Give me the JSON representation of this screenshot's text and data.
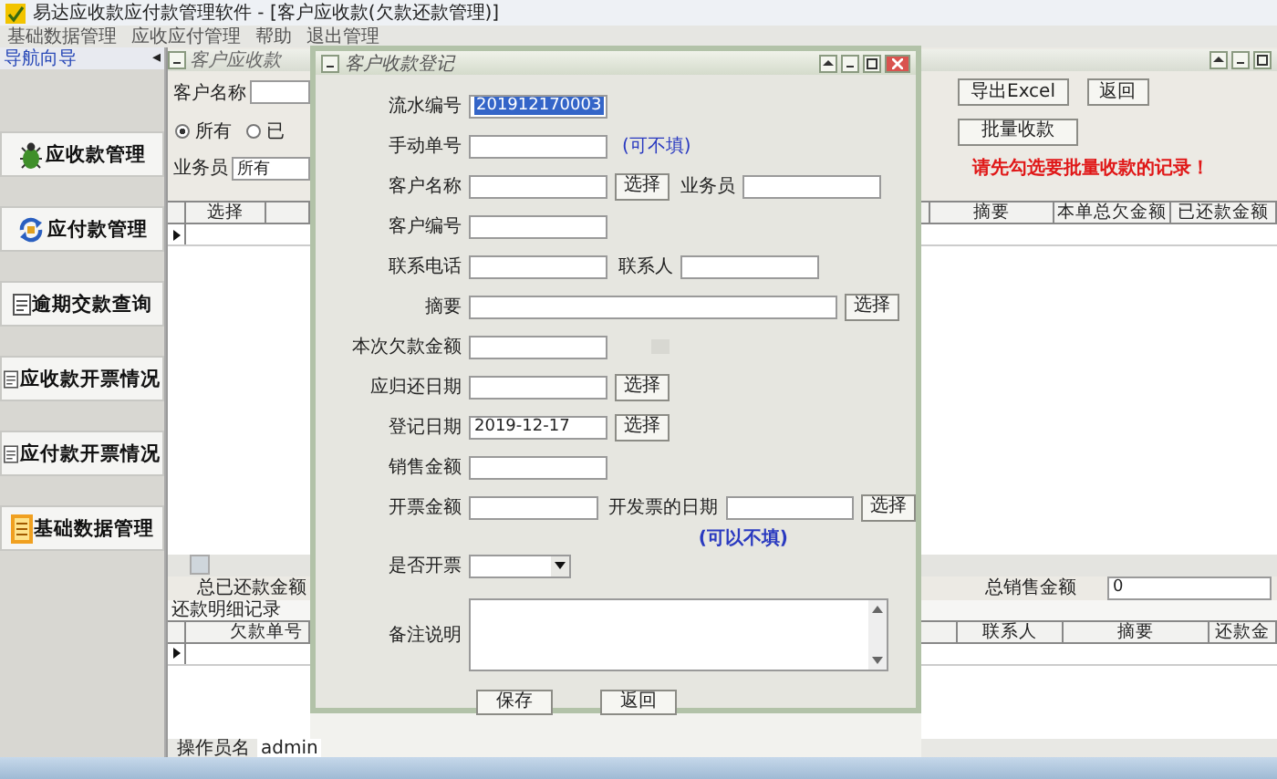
{
  "window": {
    "title": "易达应收款应付款管理软件 - [客户应收款(欠款还款管理)]"
  },
  "menu": [
    "基础数据管理",
    "应收应付管理",
    "帮助",
    "退出管理"
  ],
  "nav": {
    "title": "导航向导",
    "collapse": "◂",
    "items": [
      "应收款管理",
      "应付款管理",
      "逾期交款查询",
      "应收款开票情况",
      "应付款开票情况",
      "基础数据管理"
    ]
  },
  "main": {
    "title": "客户应收款",
    "customer_label": "客户名称",
    "radios": [
      {
        "label": "所有",
        "selected": true
      },
      {
        "label": "已",
        "selected": false
      }
    ],
    "salesman_label": "业务员",
    "salesman_value": "所有",
    "buttons": [
      "导出Excel",
      "返回"
    ],
    "batch_button": "批量收款",
    "notice": "请先勾选要批量收款的记录！",
    "columns_left": [
      "选择"
    ],
    "columns_right": [
      "摘要",
      "本单总欠金额",
      "已还款金额"
    ],
    "total_repaid_label": "总已还款金额",
    "total_sales_label": "总销售金额",
    "total_sales_value": "0",
    "detail_title": "还款明细记录",
    "detail_columns_left": [
      "欠款单号"
    ],
    "detail_columns_right": [
      "联系人",
      "摘要",
      "还款金"
    ],
    "operator_label": "操作员名",
    "operator_value": "admin"
  },
  "dialog": {
    "title": "客户收款登记",
    "rows": [
      {
        "items": [
          {
            "kind": "label",
            "text": "流水编号"
          },
          {
            "kind": "highlighted-field",
            "value": "201912170003"
          }
        ]
      },
      {
        "items": [
          {
            "kind": "label",
            "text": "手动单号"
          },
          {
            "kind": "field"
          },
          {
            "kind": "note",
            "text": "(可不填)"
          }
        ]
      },
      {
        "items": [
          {
            "kind": "label",
            "text": "客户名称"
          },
          {
            "kind": "field"
          },
          {
            "kind": "button",
            "text": "选择"
          },
          {
            "kind": "inline-label",
            "text": "业务员"
          },
          {
            "kind": "field"
          }
        ]
      },
      {
        "items": [
          {
            "kind": "label",
            "text": "客户编号"
          },
          {
            "kind": "field"
          }
        ]
      },
      {
        "items": [
          {
            "kind": "label",
            "text": "联系电话"
          },
          {
            "kind": "field"
          },
          {
            "kind": "inline-label",
            "text": "联系人"
          },
          {
            "kind": "field"
          }
        ]
      },
      {
        "items": [
          {
            "kind": "label",
            "text": "摘要"
          },
          {
            "kind": "wide-field"
          },
          {
            "kind": "button",
            "text": "选择"
          }
        ]
      },
      {
        "items": [
          {
            "kind": "label",
            "text": "本次欠款金额"
          },
          {
            "kind": "field"
          },
          {
            "kind": "disabled-box"
          }
        ]
      },
      {
        "items": [
          {
            "kind": "label",
            "text": "应归还日期"
          },
          {
            "kind": "field"
          },
          {
            "kind": "button",
            "text": "选择"
          }
        ]
      },
      {
        "items": [
          {
            "kind": "label",
            "text": "登记日期"
          },
          {
            "kind": "field",
            "value": "2019-12-17"
          },
          {
            "kind": "button",
            "text": "选择"
          }
        ]
      },
      {
        "items": [
          {
            "kind": "label",
            "text": "销售金额"
          },
          {
            "kind": "field"
          }
        ]
      },
      {
        "items": [
          {
            "kind": "label",
            "text": "开票金额"
          },
          {
            "kind": "field"
          },
          {
            "kind": "inline-label",
            "text": "开发票的日期"
          },
          {
            "kind": "field"
          },
          {
            "kind": "button",
            "text": "选择"
          }
        ]
      },
      {
        "items": [
          {
            "kind": "bold-note",
            "text": "(可以不填)"
          }
        ]
      },
      {
        "items": [
          {
            "kind": "label",
            "text": "是否开票"
          },
          {
            "kind": "dropdown"
          }
        ]
      },
      {
        "items": [
          {
            "kind": "label",
            "text": "备注说明"
          },
          {
            "kind": "textarea"
          }
        ]
      }
    ],
    "buttons": [
      "保存",
      "返回"
    ]
  }
}
